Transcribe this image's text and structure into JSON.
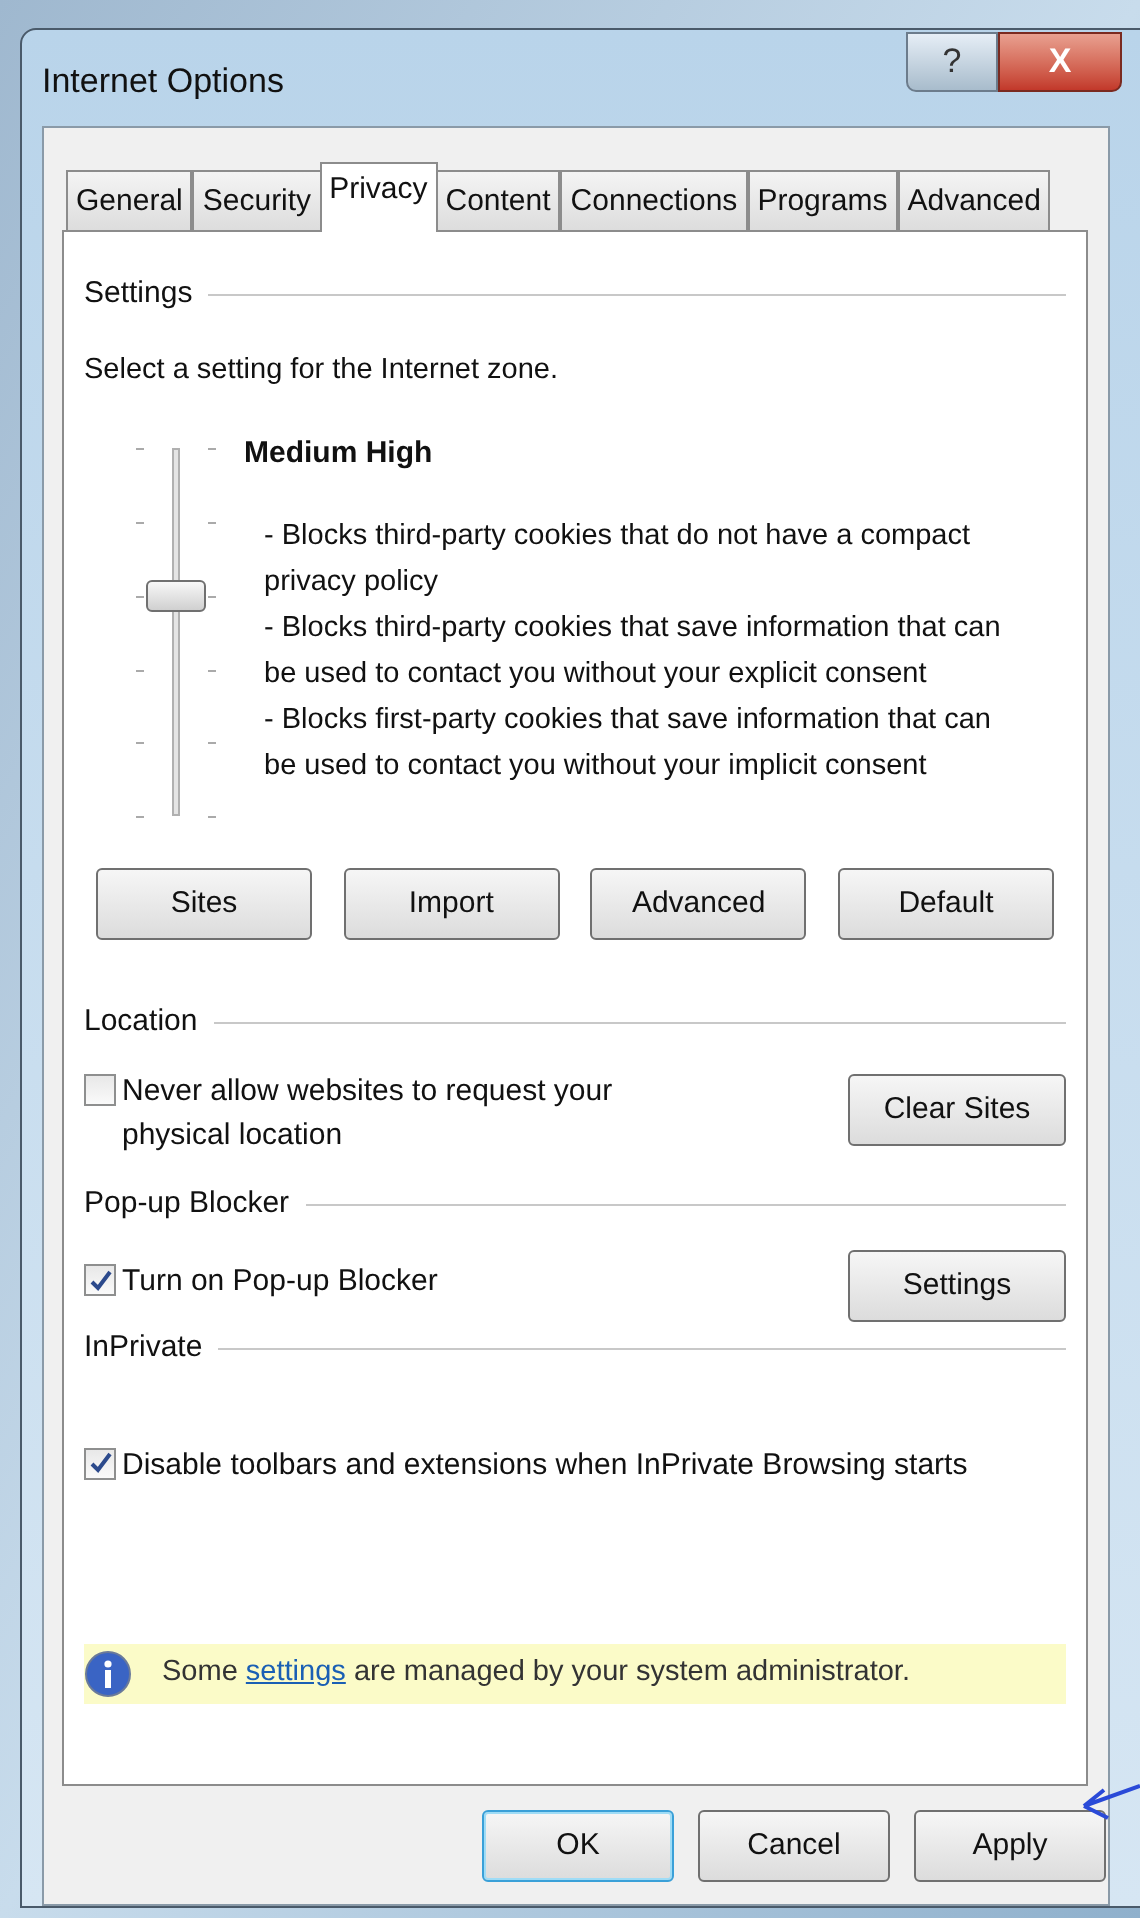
{
  "window": {
    "title": "Internet Options",
    "help": "?",
    "close": "X"
  },
  "tabs": [
    {
      "label": "General",
      "selected": false
    },
    {
      "label": "Security",
      "selected": false
    },
    {
      "label": "Privacy",
      "selected": true
    },
    {
      "label": "Content",
      "selected": false
    },
    {
      "label": "Connections",
      "selected": false
    },
    {
      "label": "Programs",
      "selected": false
    },
    {
      "label": "Advanced",
      "selected": false
    }
  ],
  "settings": {
    "heading": "Settings",
    "instruction": "Select a setting for the Internet zone.",
    "slider": {
      "level": 0.6
    },
    "level_name": "Medium High",
    "description": [
      "- Blocks third-party cookies that do not have a compact privacy policy",
      "- Blocks third-party cookies that save information that can be used to contact you without your explicit consent",
      "- Blocks first-party cookies that save information that can be used to contact you without your implicit consent"
    ],
    "buttons": [
      "Sites",
      "Import",
      "Advanced",
      "Default"
    ]
  },
  "location": {
    "heading": "Location",
    "checkbox": {
      "label": "Never allow websites to request your physical location",
      "checked": false
    },
    "button": "Clear Sites"
  },
  "popup_blocker": {
    "heading": "Pop-up Blocker",
    "checkbox": {
      "label": "Turn on Pop-up Blocker",
      "checked": true
    },
    "button": "Settings"
  },
  "inprivate": {
    "heading": "InPrivate",
    "checkbox": {
      "label": "Disable toolbars and extensions when InPrivate Browsing starts",
      "checked": true
    }
  },
  "notice": {
    "before": "Some",
    "link": "settings",
    "after": "are managed by your system administrator."
  },
  "buttons": [
    {
      "label": "OK",
      "default": true
    },
    {
      "label": "Cancel",
      "default": false
    },
    {
      "label": "Apply",
      "default": false
    }
  ]
}
